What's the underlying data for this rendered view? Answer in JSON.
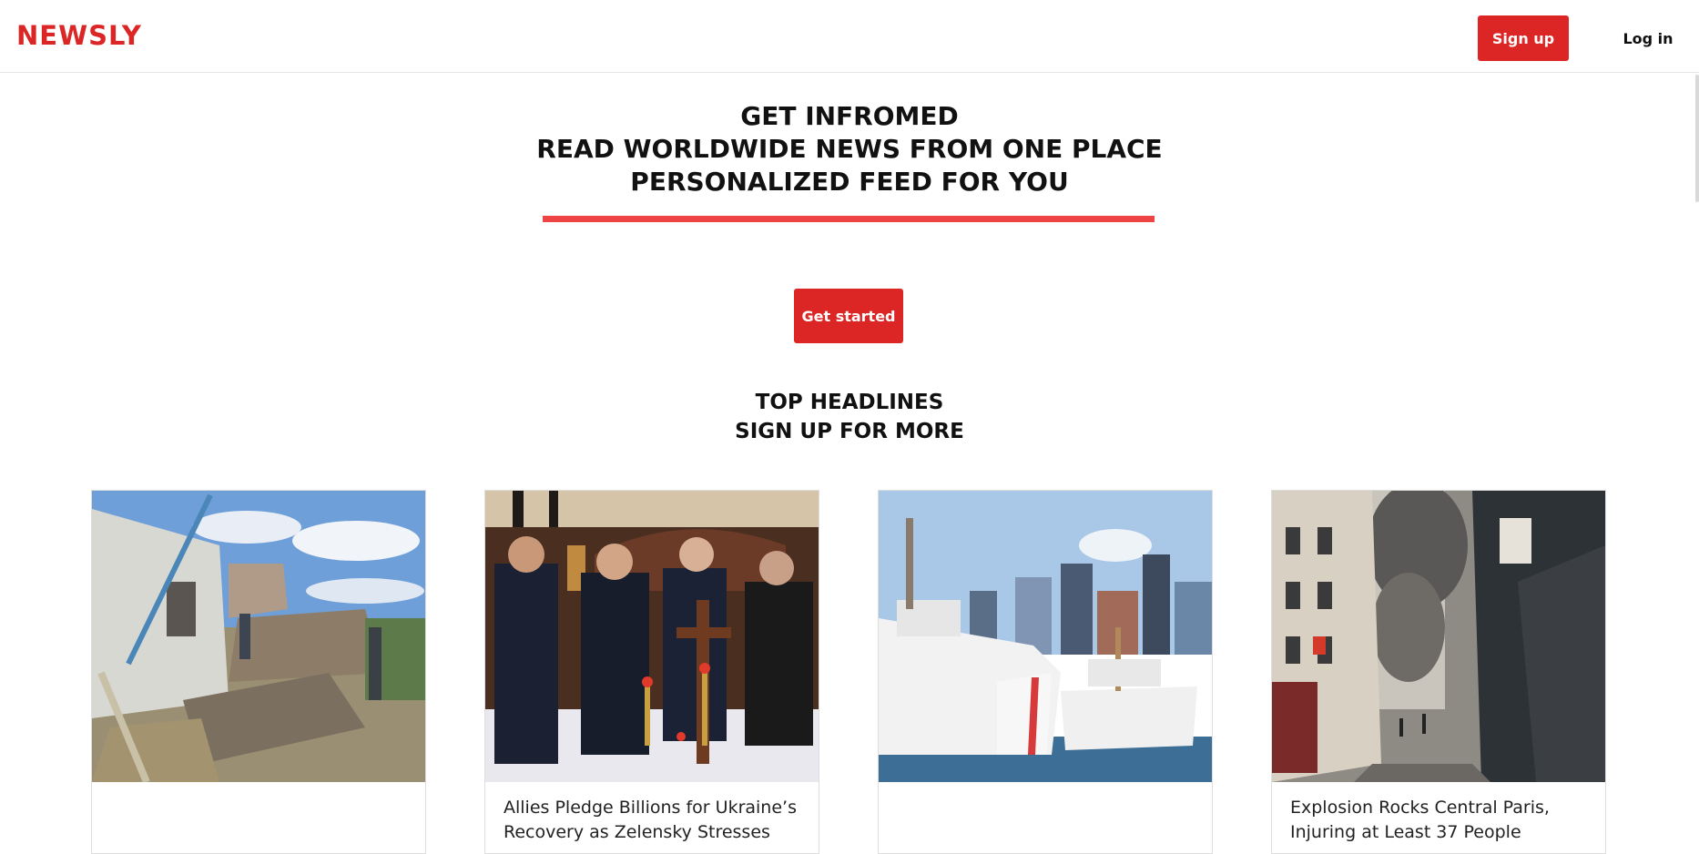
{
  "navbar": {
    "brand": "NEWSLY",
    "signup_label": "Sign up",
    "login_label": "Log in"
  },
  "hero": {
    "line1": "GET INFROMED",
    "line2": "READ WORLDWIDE NEWS FROM ONE PLACE",
    "line3": "PERSONALIZED FEED FOR YOU",
    "cta_label": "Get started"
  },
  "headlines": {
    "title": "TOP HEADLINES",
    "subtitle": "SIGN UP FOR MORE",
    "cards": [
      {
        "title": "",
        "image_icon": "war-damage-photo"
      },
      {
        "title": "Allies Pledge Billions for Ukraine’s Recovery as Zelensky Stresses",
        "image_icon": "diplomats-candles-photo"
      },
      {
        "title": "",
        "image_icon": "coast-guard-ship-photo"
      },
      {
        "title": "Explosion Rocks Central Paris, Injuring at Least 37 People",
        "image_icon": "paris-explosion-street-photo"
      }
    ]
  },
  "colors": {
    "accent": "#dc2626",
    "rule": "#ef4444"
  }
}
